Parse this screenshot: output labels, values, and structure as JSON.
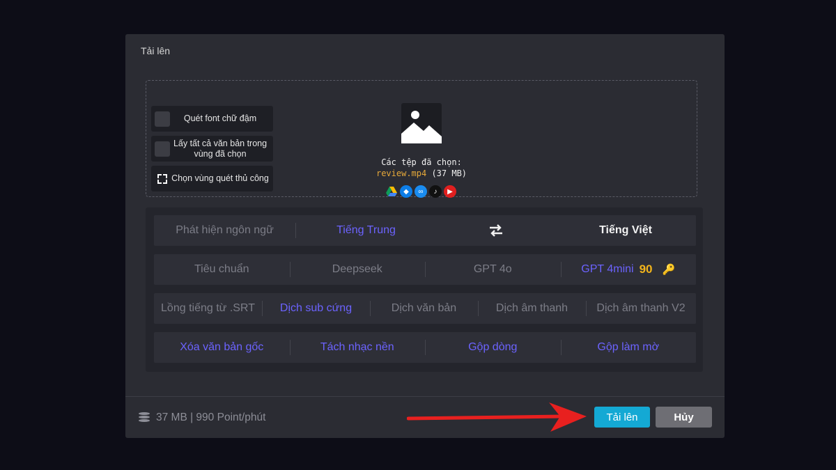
{
  "modal": {
    "title": "Tải lên"
  },
  "options": {
    "bold_font": "Quét font chữ đậm",
    "all_text": "Lấy tất cả văn bản trong vùng đã chọn",
    "manual_region": "Chọn vùng quét thủ công"
  },
  "selection": {
    "label": "Các tệp đã chọn:",
    "file_name": "review.mp4",
    "file_size": "(37 MB)",
    "sources": [
      "google-drive-icon",
      "dropbox-icon",
      "link-icon",
      "tiktok-icon",
      "youtube-icon"
    ]
  },
  "language": {
    "detect": "Phát hiện ngôn ngữ",
    "source": "Tiếng Trung",
    "swap_icon": "swap-arrows-icon",
    "target": "Tiếng Việt"
  },
  "models": {
    "standard": "Tiêu chuẩn",
    "deepseek": "Deepseek",
    "gpt4o": "GPT 4o",
    "gpt4mini": "GPT 4mini",
    "gpt4mini_badge": "90"
  },
  "modes": {
    "dub_srt": "Lồng tiếng từ .SRT",
    "hard_sub": "Dịch sub cứng",
    "text": "Dịch văn bản",
    "audio": "Dịch âm thanh",
    "audio_v2": "Dịch âm thanh V2"
  },
  "extras": {
    "remove_text": "Xóa văn bản gốc",
    "separate_music": "Tách nhạc nền",
    "merge_lines": "Gộp dòng",
    "merge_blur": "Gộp làm mờ"
  },
  "footer": {
    "info": "37 MB | 990 Point/phút",
    "upload": "Tải lên",
    "cancel": "Hủy"
  },
  "colors": {
    "accent": "#6c63ff",
    "upload_button": "#14a9d4",
    "badge": "#f2b41b",
    "arrow": "#e8201f"
  }
}
